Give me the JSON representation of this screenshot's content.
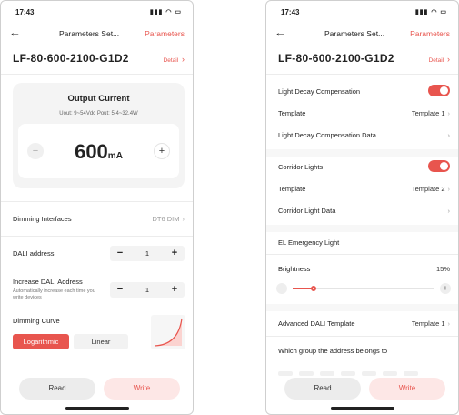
{
  "status": {
    "time": "17:43",
    "icons": "▮▮▮ ◠ ▭"
  },
  "nav": {
    "back": "←",
    "title": "Parameters Set...",
    "link": "Parameters"
  },
  "device": {
    "name": "LF-80-600-2100-G1D2",
    "detail": "Detail",
    "detail_chevron": "›"
  },
  "screen1": {
    "output": {
      "title": "Output Current",
      "spec": "Uout: 9~54Vdc   Pout: 5.4~32.4W",
      "value": "600",
      "unit": "mA",
      "minus": "−",
      "plus": "+"
    },
    "dimming_interfaces": {
      "label": "Dimming Interfaces",
      "value": "DT6 DIM",
      "chevron": "›"
    },
    "dali_address": {
      "label": "DALI address",
      "value": "1",
      "minus": "−",
      "plus": "+"
    },
    "increase_dali": {
      "label": "Increase DALI Address",
      "desc": "Automatically increase each time you write devices",
      "value": "1",
      "minus": "−",
      "plus": "+"
    },
    "dimming_curve": {
      "label": "Dimming Curve",
      "options": [
        "Logarithmic",
        "Linear"
      ],
      "selected": "Logarithmic"
    },
    "buttons": {
      "read": "Read",
      "write": "Write"
    }
  },
  "screen2": {
    "light_decay": {
      "label": "Light Decay Compensation",
      "enabled": true
    },
    "template1": {
      "label": "Template",
      "value": "Template 1",
      "chevron": "›"
    },
    "light_decay_data": {
      "label": "Light Decay Compensation Data",
      "chevron": "›"
    },
    "corridor": {
      "label": "Corridor Lights",
      "enabled": true
    },
    "template2": {
      "label": "Template",
      "value": "Template 2",
      "chevron": "›"
    },
    "corridor_data": {
      "label": "Corridor Light Data",
      "chevron": "›"
    },
    "el_emergency": {
      "label": "EL Emergency Light"
    },
    "brightness": {
      "label": "Brightness",
      "value": "15%",
      "level": 0.15,
      "minus": "−",
      "plus": "+"
    },
    "advanced_dali": {
      "label": "Advanced DALI Template",
      "value": "Template 1",
      "chevron": "›"
    },
    "group": {
      "label": "Which group the address belongs to"
    },
    "buttons": {
      "read": "Read",
      "write": "Write"
    }
  },
  "colors": {
    "accent": "#e8554e",
    "accent_light": "#fde7e6",
    "card_bg": "#f4f4f4"
  }
}
